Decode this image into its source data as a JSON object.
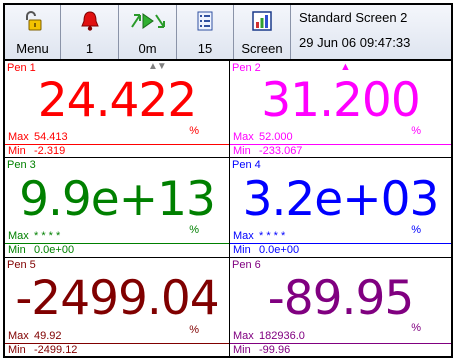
{
  "toolbar": {
    "buttons": [
      {
        "label": "Menu",
        "icon": "lock-icon"
      },
      {
        "label": "1",
        "icon": "bell-icon"
      },
      {
        "label": "0m",
        "icon": "play-icon"
      },
      {
        "label": "15",
        "icon": "list-icon"
      },
      {
        "label": "Screen",
        "icon": "chart-icon"
      }
    ],
    "screen_name": "Standard Screen 2",
    "datetime": "29 Jun 06  09:47:33"
  },
  "pens": [
    {
      "name": "Pen 1",
      "value": "24.422",
      "unit": "%",
      "max_label": "Max",
      "max": "54.413",
      "min_label": "Min",
      "min": "-2.319",
      "color": "#ff0000"
    },
    {
      "name": "Pen 2",
      "value": "31.200",
      "unit": "%",
      "max_label": "Max",
      "max": "52.000",
      "min_label": "Min",
      "min": "-233.067",
      "color": "#ff00ff"
    },
    {
      "name": "Pen 3",
      "value": "9.9e+13",
      "unit": "%",
      "max_label": "Max",
      "max": "* * * *",
      "min_label": "Min",
      "min": "0.0e+00",
      "color": "#008000"
    },
    {
      "name": "Pen 4",
      "value": "3.2e+03",
      "unit": "%",
      "max_label": "Max",
      "max": "* * * *",
      "min_label": "Min",
      "min": "0.0e+00",
      "color": "#0000ff"
    },
    {
      "name": "Pen 5",
      "value": "-2499.04",
      "unit": "%",
      "max_label": "Max",
      "max": "49.92",
      "min_label": "Min",
      "min": "-2499.12",
      "color": "#800000"
    },
    {
      "name": "Pen 6",
      "value": "-89.95",
      "unit": "%",
      "max_label": "Max",
      "max": "182936.0",
      "min_label": "Min",
      "min": "-99.96",
      "color": "#800080"
    }
  ]
}
